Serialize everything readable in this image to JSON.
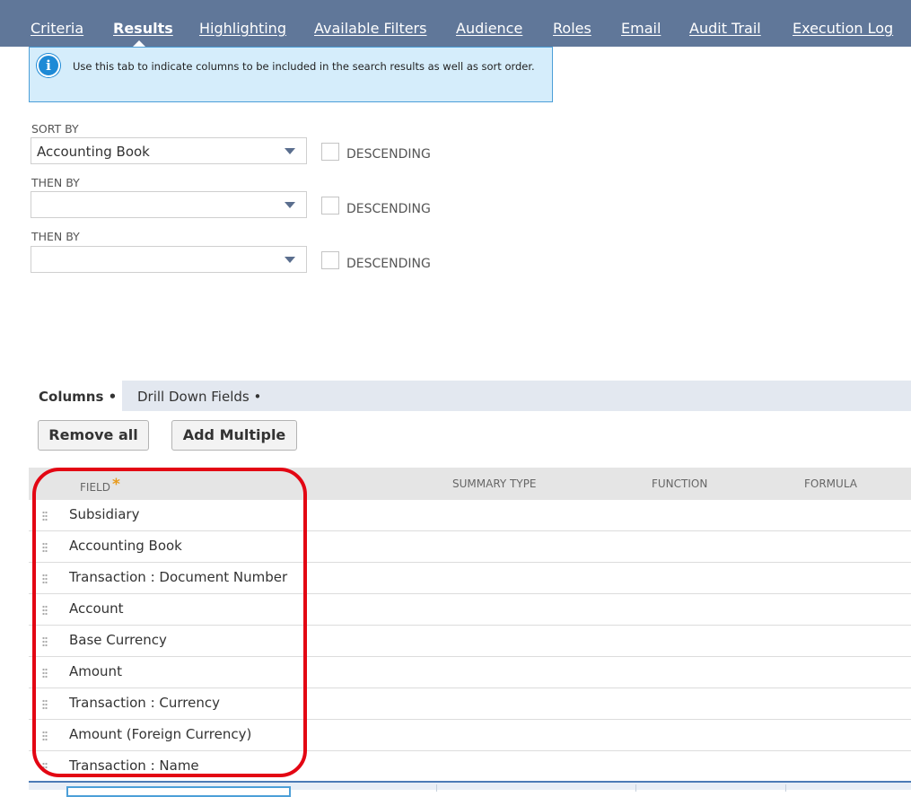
{
  "tabs": [
    {
      "label": "Criteria"
    },
    {
      "label": "Results"
    },
    {
      "label": "Highlighting"
    },
    {
      "label": "Available Filters"
    },
    {
      "label": "Audience"
    },
    {
      "label": "Roles"
    },
    {
      "label": "Email"
    },
    {
      "label": "Audit Trail"
    },
    {
      "label": "Execution Log"
    }
  ],
  "active_tab": "Results",
  "info": {
    "icon": "info-icon",
    "text": "Use this tab to indicate columns to be included in the search results as well as sort order."
  },
  "sort": [
    {
      "label": "SORT BY",
      "value": "Accounting Book",
      "descending_label": "DESCENDING",
      "descending_checked": false
    },
    {
      "label": "THEN BY",
      "value": "",
      "descending_label": "DESCENDING",
      "descending_checked": false
    },
    {
      "label": "THEN BY",
      "value": "",
      "descending_label": "DESCENDING",
      "descending_checked": false
    }
  ],
  "subtabs": [
    {
      "label": "Columns •",
      "active": true
    },
    {
      "label": "Drill Down Fields •",
      "active": false
    }
  ],
  "buttons": {
    "remove_all": "Remove all",
    "add_multiple": "Add Multiple"
  },
  "table": {
    "headers": {
      "field": "FIELD",
      "field_required": "*",
      "summary_type": "SUMMARY TYPE",
      "function": "FUNCTION",
      "formula": "FORMULA"
    },
    "rows": [
      "Subsidiary",
      "Accounting Book",
      "Transaction : Document Number",
      "Account",
      "Base Currency",
      "Amount",
      "Transaction : Currency",
      "Amount (Foreign Currency)",
      "Transaction : Name"
    ]
  },
  "colors": {
    "tabbar": "#607799",
    "info_bg": "#d5edfb",
    "highlight": "#e30613",
    "required_star": "#e79a1c"
  }
}
